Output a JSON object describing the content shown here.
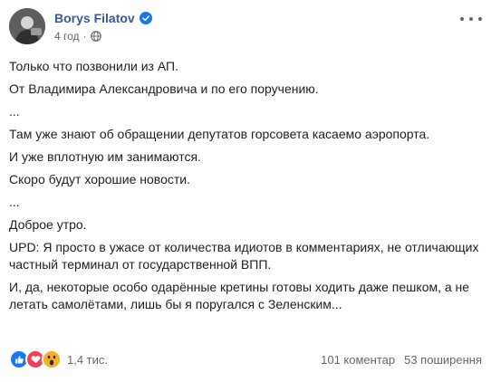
{
  "post": {
    "author": "Borys Filatov",
    "time": "4 год",
    "paragraphs": [
      "Только что позвонили из АП.",
      "От Владимира Александровича и по его поручению.",
      "...",
      "Там уже знают об обращении депутатов горсовета касаемо аэропорта.",
      "И уже вплотную им занимаются.",
      "Скоро будут хорошие новости.",
      "...",
      "Доброе утро.",
      "UPD: Я просто в ужасе от количества идиотов в комментариях, не отличающих частный терминал от государственной ВПП.",
      "И, да, некоторые особо одарённые кретины готовы ходить даже пешком, а не летать самолётами, лишь бы я поругался с Зеленским..."
    ]
  },
  "footer": {
    "reactions_count": "1,4 тис.",
    "reaction_icons": [
      "like-icon",
      "love-icon",
      "wow-icon"
    ],
    "comments": "101 коментар",
    "shares": "53 поширення"
  },
  "colors": {
    "author": "#385898",
    "text": "#1c1e21",
    "meta": "#616770",
    "like": "#1877f2",
    "love": "#f33e58",
    "wow": "#f7b125"
  }
}
